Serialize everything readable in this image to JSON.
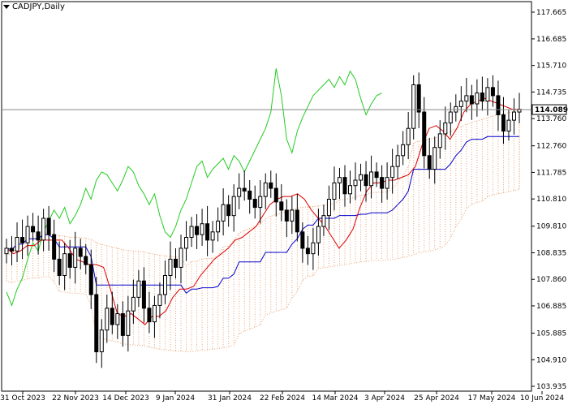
{
  "header": {
    "symbol": "CADJPY,Daily"
  },
  "chart_data": {
    "type": "candlestick",
    "symbol": "CADJPY",
    "timeframe": "Daily",
    "current_price": "114.089",
    "y_ticks": [
      "117.665",
      "116.685",
      "115.710",
      "114.735",
      "113.760",
      "112.760",
      "111.785",
      "110.810",
      "109.810",
      "108.835",
      "107.860",
      "106.885",
      "105.885",
      "104.910",
      "103.935"
    ],
    "x_ticks": [
      "31 Oct 2023",
      "22 Nov 2023",
      "14 Dec 2023",
      "9 Jan 2024",
      "31 Jan 2024",
      "22 Feb 2024",
      "14 Mar 2024",
      "3 Apr 2024",
      "25 Apr 2024",
      "17 May 2024",
      "10 Jun 2024"
    ],
    "ylim": [
      103.935,
      117.665
    ],
    "closes": [
      109.0,
      108.9,
      109.4,
      109.2,
      109.8,
      109.6,
      109.3,
      110.1,
      109.5,
      108.6,
      108.0,
      108.8,
      108.3,
      109.0,
      108.7,
      108.4,
      107.3,
      105.2,
      106.0,
      106.8,
      106.2,
      106.6,
      105.8,
      106.7,
      107.2,
      107.8,
      106.8,
      106.3,
      106.9,
      107.3,
      108.0,
      108.6,
      108.3,
      109.0,
      109.4,
      109.8,
      109.5,
      109.9,
      109.3,
      109.6,
      110.0,
      110.6,
      110.2,
      110.9,
      111.2,
      111.1,
      110.8,
      110.5,
      110.9,
      111.4,
      111.2,
      110.7,
      110.4,
      110.0,
      110.4,
      109.6,
      109.0,
      108.8,
      109.2,
      109.8,
      110.2,
      110.8,
      111.4,
      111.6,
      111.0,
      111.3,
      111.5,
      111.7,
      111.3,
      111.8,
      111.6,
      111.2,
      111.6,
      112.0,
      112.4,
      112.8,
      113.4,
      115.0,
      114.0,
      112.4,
      111.9,
      112.7,
      113.2,
      113.6,
      114.0,
      114.2,
      114.4,
      114.6,
      114.3,
      114.7,
      114.4,
      114.9,
      114.6,
      113.9,
      113.3,
      113.7,
      114.0,
      114.1
    ],
    "tenkan_sen": [
      109.0,
      108.8,
      108.9,
      109.1,
      109.1,
      109.3,
      109.3,
      109.3,
      109.3,
      109.0,
      108.6,
      108.5,
      108.4,
      108.4,
      108.3,
      107.5,
      106.6,
      106.5,
      106.6,
      106.4,
      106.2,
      106.5,
      106.5,
      106.7,
      107.2,
      107.5,
      107.5,
      107.6,
      108.0,
      108.3,
      108.6,
      108.8,
      109.0,
      109.3,
      109.4,
      109.6,
      109.8,
      110.2,
      110.6,
      110.8,
      110.9,
      110.9,
      111.0,
      110.8,
      110.4,
      110.1,
      109.8,
      109.4,
      109.0,
      109.3,
      109.7,
      110.5,
      111.1,
      111.4,
      111.4,
      111.5,
      111.5,
      111.6,
      111.7,
      112.0,
      112.8,
      113.4,
      113.5,
      113.3,
      113.0,
      113.4,
      114.0,
      114.3,
      114.4,
      114.5,
      114.4,
      114.3,
      114.2,
      114.1,
      114.1
    ]
  }
}
